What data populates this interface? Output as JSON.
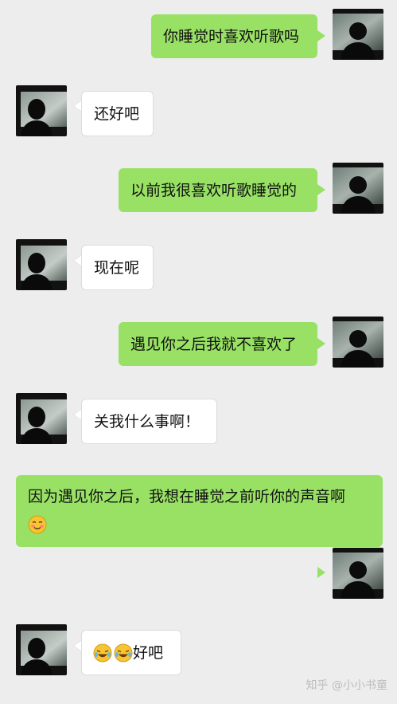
{
  "messages": [
    {
      "side": "right",
      "text": "你睡觉时喜欢听歌吗"
    },
    {
      "side": "left",
      "text": "还好吧"
    },
    {
      "side": "right",
      "text": "以前我很喜欢听歌睡觉的"
    },
    {
      "side": "left",
      "text": "现在呢"
    },
    {
      "side": "right",
      "text": "遇见你之后我就不喜欢了"
    },
    {
      "side": "left",
      "text": "关我什么事啊！"
    },
    {
      "side": "right",
      "text": "因为遇见你之后，我想在睡觉之前听你的声音啊",
      "emoji": "blushing-smile-emoji"
    },
    {
      "side": "left",
      "text": "好吧",
      "emojis": [
        "crying-laughing-emoji",
        "crying-laughing-emoji"
      ]
    }
  ],
  "watermark": "知乎 @小小书童",
  "colors": {
    "background": "#ededed",
    "sent_bubble": "#98e165",
    "received_bubble": "#ffffff"
  }
}
